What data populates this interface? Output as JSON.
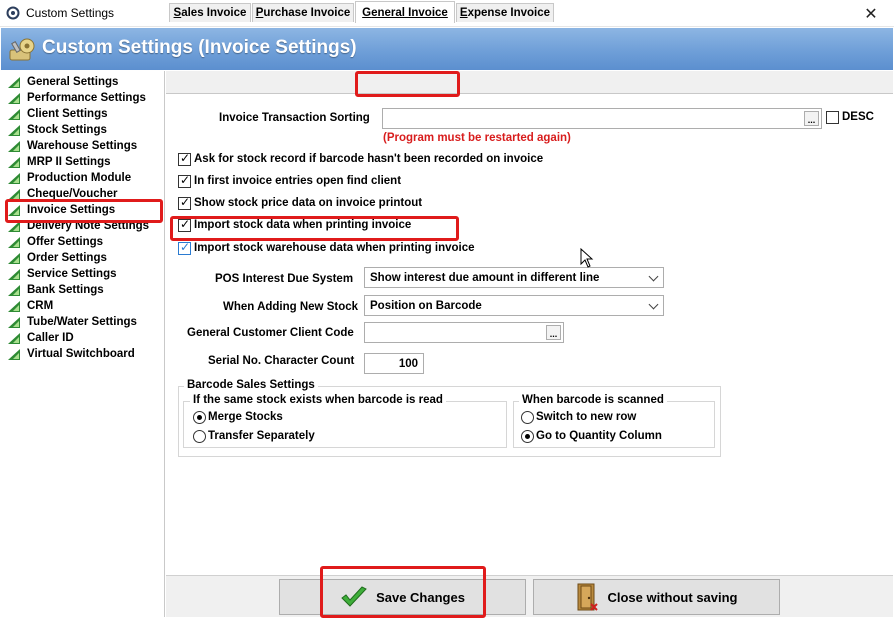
{
  "window": {
    "title": "Custom Settings",
    "close_glyph": "✕"
  },
  "banner": {
    "title": "Custom Settings (Invoice Settings)",
    "icon": "settings-gear-icon"
  },
  "sidebar": {
    "items": [
      {
        "label": "General Settings"
      },
      {
        "label": "Performance Settings"
      },
      {
        "label": "Client Settings"
      },
      {
        "label": "Stock Settings"
      },
      {
        "label": "Warehouse Settings"
      },
      {
        "label": "MRP II Settings"
      },
      {
        "label": "Production Module"
      },
      {
        "label": "Cheque/Voucher"
      },
      {
        "label": "Invoice Settings"
      },
      {
        "label": "Delivery Note Settings"
      },
      {
        "label": "Offer Settings"
      },
      {
        "label": "Order Settings"
      },
      {
        "label": "Service Settings"
      },
      {
        "label": "Bank Settings"
      },
      {
        "label": "CRM"
      },
      {
        "label": "Tube/Water Settings"
      },
      {
        "label": "Caller ID"
      },
      {
        "label": "Virtual Switchboard"
      }
    ],
    "selected": "Invoice Settings"
  },
  "tabs": {
    "sales": {
      "first": "S",
      "rest": "ales Invoice"
    },
    "purchase": {
      "first": "P",
      "rest": "urchase Invoice"
    },
    "general": {
      "first": "G",
      "rest": "eneral Invoice"
    },
    "expense": {
      "first": "E",
      "rest": "xpense Invoice"
    },
    "active": "General Invoice"
  },
  "form": {
    "sorting_label": "Invoice Transaction Sorting",
    "sorting_value": "",
    "restart_warning": "(Program must be restarted again)",
    "desc_label": "DESC",
    "desc_checked": false,
    "checkboxes": [
      {
        "label": "Ask for stock record if barcode hasn't been recorded on invoice",
        "checked": true
      },
      {
        "label": "In first invoice entries open find client",
        "checked": true
      },
      {
        "label": "Show stock price data on invoice printout",
        "checked": true
      },
      {
        "label": "Import stock data when printing invoice",
        "checked": true
      },
      {
        "label": "Import stock warehouse data when printing invoice",
        "checked": true
      }
    ],
    "pos_interest_label": "POS Interest Due System",
    "pos_interest_value": "Show interest due amount in different line",
    "adding_stock_label": "When Adding New Stock",
    "adding_stock_value": "Position on Barcode",
    "client_code_label": "General Customer Client Code",
    "client_code_value": "",
    "serial_label": "Serial No. Character Count",
    "serial_value": "100",
    "ellipsis": "..."
  },
  "barcode": {
    "title": "Barcode Sales Settings",
    "same_stock_title": "If the same stock exists when barcode is read",
    "merge_label": "Merge Stocks",
    "transfer_label": "Transfer Separately",
    "same_stock_selected": "Merge Stocks",
    "scanned_title": "When barcode is scanned",
    "switch_row_label": "Switch to new row",
    "goto_qty_label": "Go to Quantity Column",
    "scanned_selected": "Go to Quantity Column"
  },
  "buttons": {
    "save": "Save Changes",
    "close": "Close without saving"
  },
  "colors": {
    "banner": "#6f9fd8",
    "highlight": "#e01b1b",
    "warning": "#d81d1d",
    "check_blue": "#2b7bd1"
  }
}
